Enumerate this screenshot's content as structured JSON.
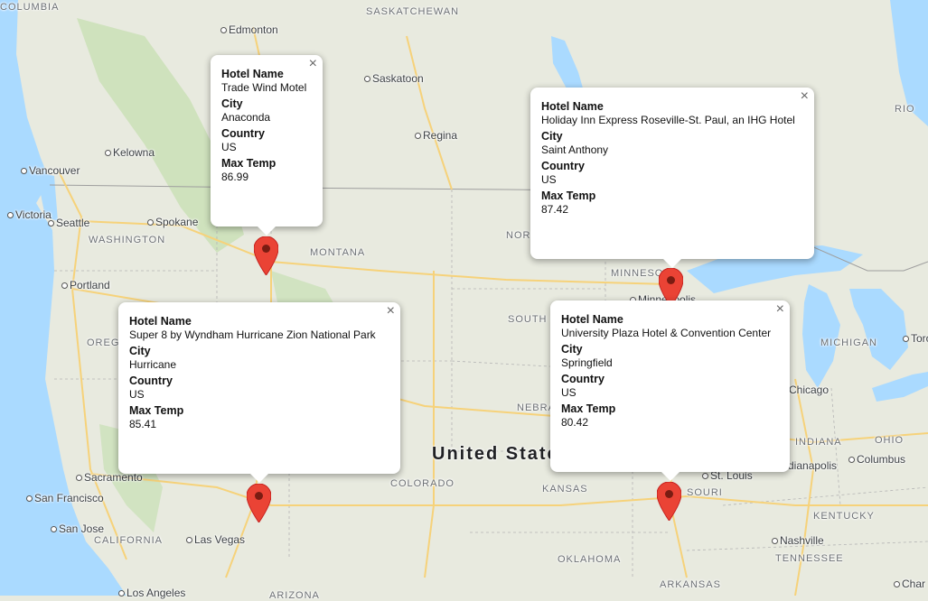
{
  "map": {
    "country_label": "United States",
    "labels": [
      {
        "text": "COLUMBIA",
        "kind": "state"
      },
      {
        "text": "SASKATCHEWAN",
        "kind": "state"
      },
      {
        "text": "Edmonton",
        "kind": "city"
      },
      {
        "text": "Saskatoon",
        "kind": "city"
      },
      {
        "text": "Regina",
        "kind": "city"
      },
      {
        "text": "Kelowna",
        "kind": "city"
      },
      {
        "text": "Vancouver",
        "kind": "city"
      },
      {
        "text": "Victoria",
        "kind": "city"
      },
      {
        "text": "Seattle",
        "kind": "city"
      },
      {
        "text": "Spokane",
        "kind": "city"
      },
      {
        "text": "WASHINGTON",
        "kind": "state"
      },
      {
        "text": "MONTANA",
        "kind": "state"
      },
      {
        "text": "Portland",
        "kind": "city"
      },
      {
        "text": "OREG",
        "kind": "state"
      },
      {
        "text": "NORTH DAKO",
        "kind": "state"
      },
      {
        "text": "MINNESOTA",
        "kind": "state"
      },
      {
        "text": "SOUTH DAKOTA",
        "kind": "state"
      },
      {
        "text": "MICHIGAN",
        "kind": "state"
      },
      {
        "text": "NEBRA",
        "kind": "state"
      },
      {
        "text": "COLORADO",
        "kind": "state"
      },
      {
        "text": "KANSAS",
        "kind": "state"
      },
      {
        "text": "Sacramento",
        "kind": "city"
      },
      {
        "text": "San Francisco",
        "kind": "city"
      },
      {
        "text": "San Jose",
        "kind": "city"
      },
      {
        "text": "CALIFORNIA",
        "kind": "state"
      },
      {
        "text": "Las Vegas",
        "kind": "city"
      },
      {
        "text": "Los Angeles",
        "kind": "city"
      },
      {
        "text": "ARIZONA",
        "kind": "state"
      },
      {
        "text": "INDIANA",
        "kind": "state"
      },
      {
        "text": "OHIO",
        "kind": "state"
      },
      {
        "text": "Indianapolis",
        "kind": "city"
      },
      {
        "text": "Columbus",
        "kind": "city"
      },
      {
        "text": "St. Louis",
        "kind": "city"
      },
      {
        "text": "SOURI",
        "kind": "state"
      },
      {
        "text": "KENTUCKY",
        "kind": "state"
      },
      {
        "text": "Nashville",
        "kind": "city"
      },
      {
        "text": "TENNESSEE",
        "kind": "state"
      },
      {
        "text": "OKLAHOMA",
        "kind": "state"
      },
      {
        "text": "ARKANSAS",
        "kind": "state"
      },
      {
        "text": "Minneapolis",
        "kind": "city"
      },
      {
        "text": "Chicago",
        "kind": "city"
      },
      {
        "text": "Toro",
        "kind": "city"
      },
      {
        "text": "Char",
        "kind": "city"
      },
      {
        "text": "RIO",
        "kind": "state"
      }
    ]
  },
  "field_labels": {
    "hotel": "Hotel Name",
    "city": "City",
    "country": "Country",
    "max_temp": "Max Temp"
  },
  "close_glyph": "×",
  "popups": [
    {
      "hotel": "Trade Wind Motel",
      "city": "Anaconda",
      "country": "US",
      "max_temp": "86.99"
    },
    {
      "hotel": "Holiday Inn Express Roseville-St. Paul, an IHG Hotel",
      "city": "Saint Anthony",
      "country": "US",
      "max_temp": "87.42"
    },
    {
      "hotel": "Super 8 by Wyndham Hurricane Zion National Park",
      "city": "Hurricane",
      "country": "US",
      "max_temp": "85.41"
    },
    {
      "hotel": "University Plaza Hotel & Convention Center",
      "city": "Springfield",
      "country": "US",
      "max_temp": "80.42"
    }
  ],
  "colors": {
    "land": "#e8eadf",
    "water": "#aadaff",
    "park": "#c8e0b4",
    "road": "#f6d27a",
    "border": "#9e9e9e",
    "marker": "#ea4335",
    "marker_dot": "#7a1c12"
  }
}
